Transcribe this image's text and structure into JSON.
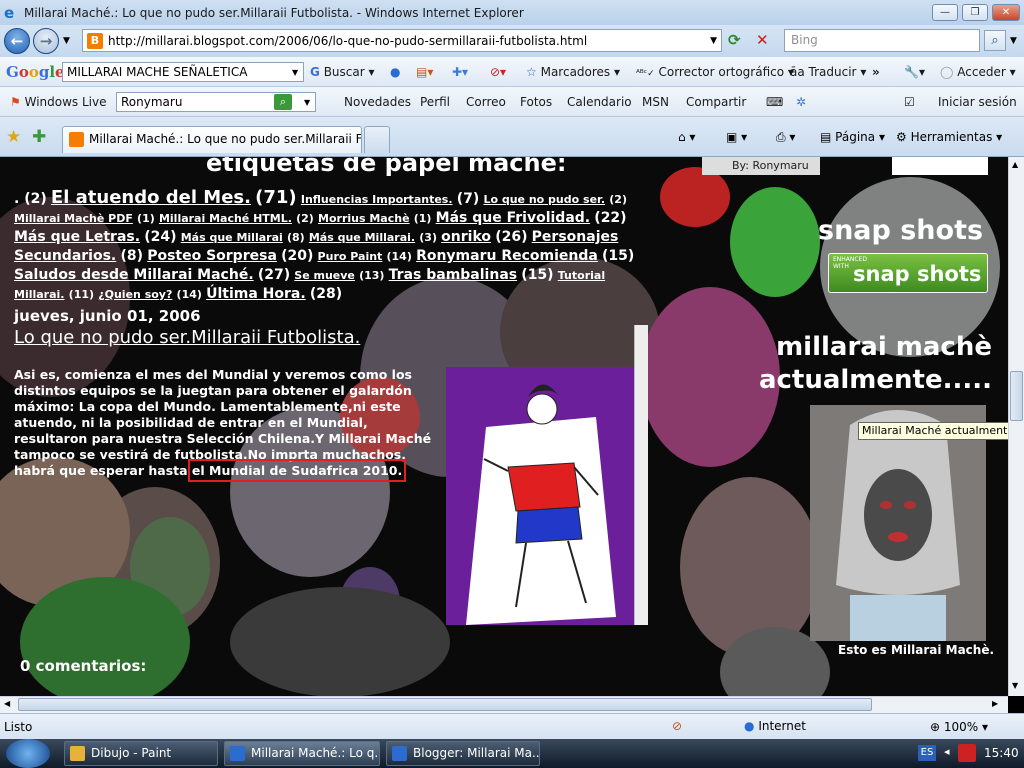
{
  "window": {
    "title": "Millarai Maché.: Lo que no pudo ser.Millaraii Futbolista. - Windows Internet Explorer"
  },
  "address_bar": {
    "url": "http://millarai.blogspot.com/2006/06/lo-que-no-pudo-sermillaraii-futbolista.html",
    "search_placeholder": "Bing"
  },
  "google_toolbar": {
    "logo": "Google",
    "search_value": "MILLARAI MACHE SEÑALETICA",
    "buscar": "Buscar",
    "marcadores": "Marcadores",
    "corrector": "Corrector ortográfico",
    "traducir": "Traducir",
    "acceder": "Acceder"
  },
  "live_toolbar": {
    "brand": "Windows Live",
    "search_value": "Ronymaru",
    "items": [
      "Novedades",
      "Perfil",
      "Correo",
      "Fotos",
      "Calendario",
      "MSN",
      "Compartir"
    ],
    "signin": "Iniciar sesión"
  },
  "tabs": {
    "active_label": "Millarai Maché.: Lo que no pudo ser.Millaraii Fut...",
    "pagina": "Página",
    "herramientas": "Herramientas"
  },
  "page": {
    "header_partial": "etiquetas de papel maché:",
    "by_user": "By: Ronymaru",
    "labels": [
      {
        "t": ". (2)",
        "size": "mid"
      },
      {
        "t": "El atuendo del Mes.",
        "size": "big",
        "link": true
      },
      {
        "t": "(71)",
        "size": "big"
      },
      {
        "t": "Influencias Importantes.",
        "size": "sm",
        "link": true
      },
      {
        "t": "(7)",
        "size": "mid"
      },
      {
        "t": "Lo que no pudo ser.",
        "size": "sm",
        "link": true
      },
      {
        "t": "(2)",
        "size": "sm"
      },
      {
        "t": "Millarai Machè PDF",
        "size": "sm",
        "link": true
      },
      {
        "t": "(1)",
        "size": "sm"
      },
      {
        "t": "Millarai Maché HTML.",
        "size": "sm",
        "link": true
      },
      {
        "t": "(2)",
        "size": "sm"
      },
      {
        "t": "Morrius Machè",
        "size": "sm",
        "link": true
      },
      {
        "t": "(1)",
        "size": "sm"
      },
      {
        "t": "Más que Frivolidad.",
        "size": "mid",
        "link": true
      },
      {
        "t": "(22)",
        "size": "mid"
      },
      {
        "t": "Más que Letras.",
        "size": "mid",
        "link": true
      },
      {
        "t": "(24)",
        "size": "mid"
      },
      {
        "t": "Más que Millarai",
        "size": "sm",
        "link": true
      },
      {
        "t": "(8)",
        "size": "sm"
      },
      {
        "t": "Más que Millarai.",
        "size": "sm",
        "link": true
      },
      {
        "t": "(3)",
        "size": "sm"
      },
      {
        "t": "onriko",
        "size": "mid",
        "link": true
      },
      {
        "t": "(26)",
        "size": "mid"
      },
      {
        "t": "Personajes Secundarios.",
        "size": "mid",
        "link": true
      },
      {
        "t": "(8)",
        "size": "mid"
      },
      {
        "t": "Posteo Sorpresa",
        "size": "mid",
        "link": true
      },
      {
        "t": "(20)",
        "size": "mid"
      },
      {
        "t": "Puro Paint",
        "size": "sm",
        "link": true
      },
      {
        "t": "(14)",
        "size": "sm"
      },
      {
        "t": "Ronymaru Recomienda",
        "size": "mid",
        "link": true
      },
      {
        "t": "(15)",
        "size": "mid"
      },
      {
        "t": "Saludos desde Millarai Maché.",
        "size": "mid",
        "link": true
      },
      {
        "t": "(27)",
        "size": "mid"
      },
      {
        "t": "Se mueve",
        "size": "sm",
        "link": true
      },
      {
        "t": "(13)",
        "size": "sm"
      },
      {
        "t": "Tras bambalinas",
        "size": "mid",
        "link": true
      },
      {
        "t": "(15)",
        "size": "mid"
      },
      {
        "t": "Tutorial Millarai.",
        "size": "sm",
        "link": true
      },
      {
        "t": "(11)",
        "size": "sm"
      },
      {
        "t": "¿Quien soy?",
        "size": "sm",
        "link": true
      },
      {
        "t": "(14)",
        "size": "sm"
      },
      {
        "t": "Última Hora.",
        "size": "mid",
        "link": true
      },
      {
        "t": "(28)",
        "size": "mid"
      }
    ],
    "date": "jueves, junio 01, 2006",
    "post_title": "Lo que no pudo ser.Millaraii Futbolista.",
    "post_body": "Asi es, comienza el mes del Mundial y veremos como los distintos equipos se la juegtan para obtener el galardón máximo: La copa del Mundo. Lamentablemente,ni este atuendo, ni la posibilidad de entrar en el Mundial, resultaron para nuestra Selección Chilena.Y Millarai Maché tampoco se vestirá de futbolista.No imprta muchachos, habrá que esperar hasta ",
    "post_highlight": "el Mundial de Sudafrica 2010.",
    "comments": "0 comentarios:",
    "sidebar": {
      "snap_title": "snap shots",
      "snap_badge_small": "ENHANCED WITH",
      "snap_badge_big": "snap shots",
      "millarai_title": "millarai machè actualmente.....",
      "tooltip": "Millarai Maché actualmente....",
      "caption": "Esto es Millarai Machè."
    }
  },
  "status": {
    "text": "Listo",
    "zone": "Internet",
    "zoom": "100%"
  },
  "taskbar": {
    "tasks": [
      "Dibujo - Paint",
      "Millarai Maché.: Lo q...",
      "Blogger: Millarai Ma..."
    ],
    "lang": "ES",
    "time": "15:40"
  }
}
